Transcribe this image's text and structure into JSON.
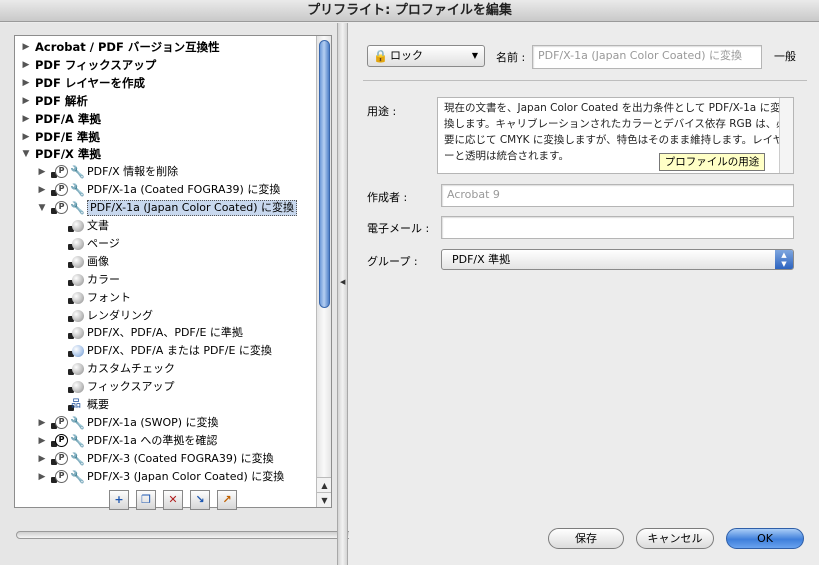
{
  "window": {
    "title": "プリフライト: プロファイルを編集"
  },
  "tree": {
    "top_items": [
      {
        "label": "Acrobat / PDF バージョン互換性",
        "expanded": false
      },
      {
        "label": "PDF フィックスアップ",
        "expanded": false
      },
      {
        "label": "PDF レイヤーを作成",
        "expanded": false
      },
      {
        "label": "PDF 解析",
        "expanded": false
      },
      {
        "label": "PDF/A 準拠",
        "expanded": false
      },
      {
        "label": "PDF/E 準拠",
        "expanded": false
      },
      {
        "label": "PDF/X 準拠",
        "expanded": true
      }
    ],
    "profiles": [
      {
        "label": "PDF/X 情報を削除"
      },
      {
        "label": "PDF/X-1a (Coated FOGRA39) に変換"
      },
      {
        "label": "PDF/X-1a (Japan Color Coated) に変換",
        "selected": true
      }
    ],
    "sections": [
      {
        "label": "文書"
      },
      {
        "label": "ページ"
      },
      {
        "label": "画像"
      },
      {
        "label": "カラー"
      },
      {
        "label": "フォント"
      },
      {
        "label": "レンダリング"
      },
      {
        "label": "PDF/X、PDF/A、PDF/E に準拠"
      },
      {
        "label": "PDF/X、PDF/A または PDF/E に変換"
      },
      {
        "label": "カスタムチェック"
      },
      {
        "label": "フィックスアップ"
      },
      {
        "label": "概要"
      }
    ],
    "more_profiles": [
      {
        "label": "PDF/X-1a (SWOP) に変換"
      },
      {
        "label": "PDF/X-1a への準拠を確認"
      },
      {
        "label": "PDF/X-3 (Coated FOGRA39) に変換"
      },
      {
        "label": "PDF/X-3 (Japan Color Coated) に変換"
      }
    ]
  },
  "right": {
    "lock_label": "ロック",
    "name_label": "名前 :",
    "name_value": "PDF/X-1a (Japan Color Coated) に変換",
    "general": "一般",
    "purpose_label": "用途 :",
    "purpose_text": "現在の文書を、Japan Color Coated を出力条件として PDF/X-1a に変換します。キャリブレーションされたカラーとデバイス依存 RGB は、必要に応じて CMYK に変換しますが、特色はそのまま維持します。レイヤーと透明は統合されます。",
    "tooltip": "プロファイルの用途",
    "author_label": "作成者 :",
    "author_value": "Acrobat 9",
    "email_label": "電子メール :",
    "email_value": "",
    "group_label": "グループ :",
    "group_value": "PDF/X 準拠"
  },
  "buttons": {
    "save": "保存",
    "cancel": "キャンセル",
    "ok": "OK"
  }
}
